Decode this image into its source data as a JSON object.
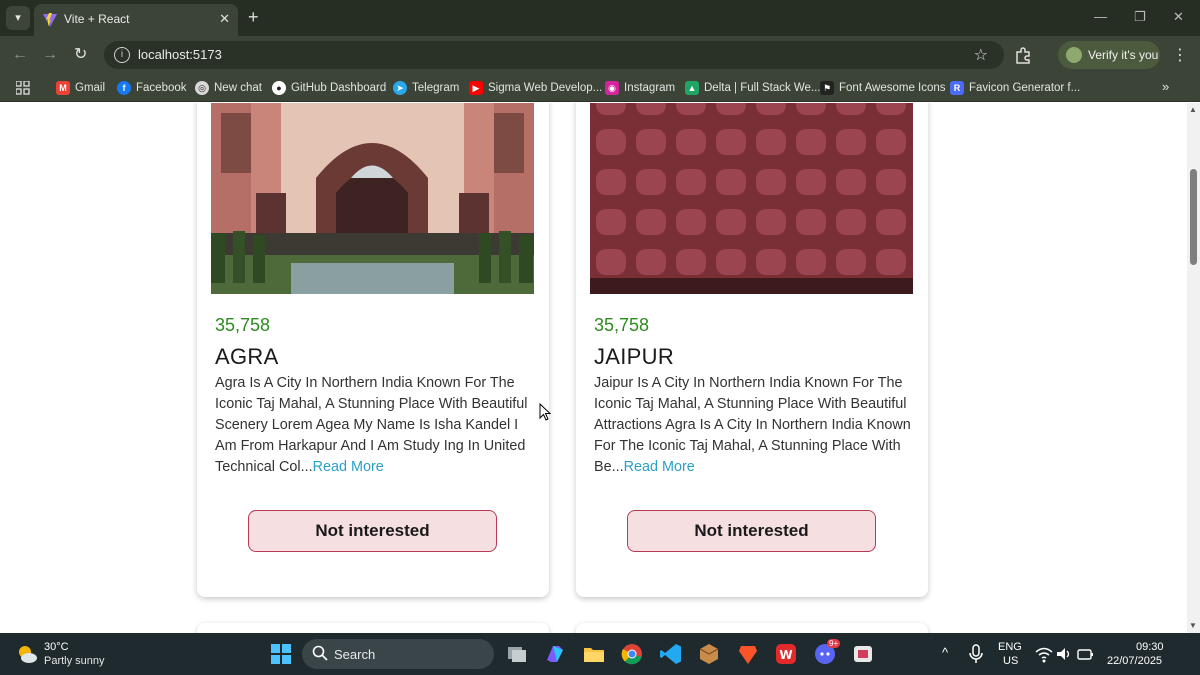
{
  "browser": {
    "tab_title": "Vite + React",
    "url": "localhost:5173",
    "profile_label": "Verify it's you",
    "bookmarks": [
      {
        "label": "Gmail",
        "icon": "gmail-icon",
        "color": "#ea4335"
      },
      {
        "label": "Facebook",
        "icon": "facebook-icon",
        "color": "#1877f2"
      },
      {
        "label": "New chat",
        "icon": "chat-icon",
        "color": "#d8d8d8"
      },
      {
        "label": "GitHub Dashboard",
        "icon": "github-icon",
        "color": "#ffffff"
      },
      {
        "label": "Telegram",
        "icon": "telegram-icon",
        "color": "#29a9eb"
      },
      {
        "label": "Sigma Web Develop...",
        "icon": "youtube-icon",
        "color": "#ff0000"
      },
      {
        "label": "Instagram",
        "icon": "instagram-icon",
        "color": "#d6249f"
      },
      {
        "label": "Delta | Full Stack We...",
        "icon": "drive-icon",
        "color": "#1fa463"
      },
      {
        "label": "Font Awesome Icons",
        "icon": "flag-icon",
        "color": "#222222"
      },
      {
        "label": "Favicon Generator f...",
        "icon": "favicon-icon",
        "color": "#4a6cf7"
      }
    ]
  },
  "cards": [
    {
      "price": "35,758",
      "title": "AGRA",
      "description": "Agra Is A City In Northern India Known For The Iconic Taj Mahal, A Stunning Place With Beautiful Scenery Lorem Agea My Name Is Isha Kandel I Am From Harkapur And I Am Study Ing In United Technical Col...",
      "read_more": "Read More",
      "button": "Not interested"
    },
    {
      "price": "35,758",
      "title": "JAIPUR",
      "description": "Jaipur Is A City In Northern India Known For The Iconic Taj Mahal, A Stunning Place With Beautiful Attractions Agra Is A City In Northern India Known For The Iconic Taj Mahal, A Stunning Place With Be...",
      "read_more": "Read More",
      "button": "Not interested"
    }
  ],
  "taskbar": {
    "weather_temp": "30°C",
    "weather_desc": "Partly sunny",
    "search_label": "Search",
    "lang_top": "ENG",
    "lang_bottom": "US",
    "time": "09:30",
    "date": "22/07/2025",
    "notification_badge": "9+"
  },
  "colors": {
    "price": "#2e8b1f",
    "read_more": "#2aa0c9",
    "button_bg": "#f6dfe0",
    "button_border": "#b83a55"
  }
}
